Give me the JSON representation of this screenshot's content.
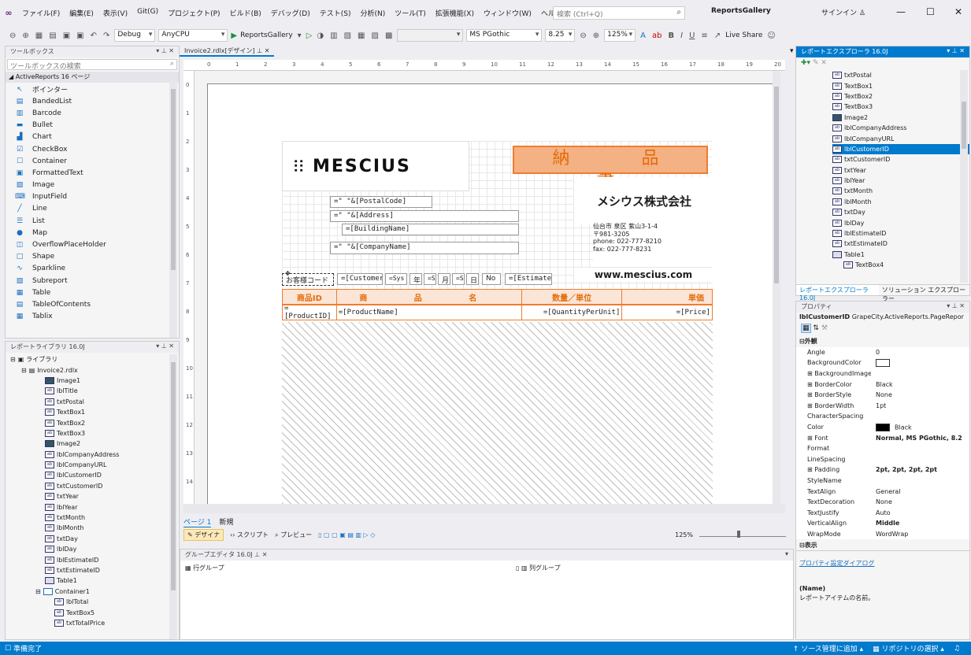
{
  "menu": {
    "items": [
      "ファイル(F)",
      "編集(E)",
      "表示(V)",
      "Git(G)",
      "プロジェクト(P)",
      "ビルド(B)",
      "デバッグ(D)",
      "テスト(S)",
      "分析(N)",
      "ツール(T)",
      "拡張機能(X)",
      "ウィンドウ(W)",
      "ヘルプ(H)"
    ],
    "search_placeholder": "検索 (Ctrl+Q)",
    "solution_name": "ReportsGallery",
    "signin": "サインイン"
  },
  "toolbar": {
    "config": "Debug",
    "platform": "AnyCPU",
    "run_label": "ReportsGallery",
    "font_name": "MS PGothic",
    "font_size": "8.25",
    "zoom": "125%",
    "live_share": "Live Share"
  },
  "toolbox": {
    "title": "ツールボックス",
    "search_placeholder": "ツールボックスの検索",
    "category": "◢ ActiveReports 16 ページ",
    "items": [
      {
        "label": "ポインター",
        "icon": "pointer-icon",
        "glyph": "↖"
      },
      {
        "label": "BandedList",
        "icon": "bandedlist-icon",
        "glyph": "▤"
      },
      {
        "label": "Barcode",
        "icon": "barcode-icon",
        "glyph": "▥"
      },
      {
        "label": "Bullet",
        "icon": "bullet-icon",
        "glyph": "▬"
      },
      {
        "label": "Chart",
        "icon": "chart-icon",
        "glyph": "▟"
      },
      {
        "label": "CheckBox",
        "icon": "checkbox-icon",
        "glyph": "☑"
      },
      {
        "label": "Container",
        "icon": "container-icon",
        "glyph": "☐"
      },
      {
        "label": "FormattedText",
        "icon": "formattedtext-icon",
        "glyph": "▣"
      },
      {
        "label": "Image",
        "icon": "image-icon",
        "glyph": "▨"
      },
      {
        "label": "InputField",
        "icon": "inputfield-icon",
        "glyph": "⌨"
      },
      {
        "label": "Line",
        "icon": "line-icon",
        "glyph": "╱"
      },
      {
        "label": "List",
        "icon": "list-icon",
        "glyph": "☰"
      },
      {
        "label": "Map",
        "icon": "map-icon",
        "glyph": "●"
      },
      {
        "label": "OverflowPlaceHolder",
        "icon": "overflow-icon",
        "glyph": "◫"
      },
      {
        "label": "Shape",
        "icon": "shape-icon",
        "glyph": "□"
      },
      {
        "label": "Sparkline",
        "icon": "sparkline-icon",
        "glyph": "∿"
      },
      {
        "label": "Subreport",
        "icon": "subreport-icon",
        "glyph": "▧"
      },
      {
        "label": "Table",
        "icon": "table-icon",
        "glyph": "▦"
      },
      {
        "label": "TableOfContents",
        "icon": "toc-icon",
        "glyph": "▤"
      },
      {
        "label": "Tablix",
        "icon": "tablix-icon",
        "glyph": "▦"
      }
    ]
  },
  "library": {
    "title": "レポートライブラリ 16.0J",
    "root": "ライブラリ",
    "report": "Invoice2.rdlx",
    "items": [
      {
        "label": "Image1",
        "type": "img"
      },
      {
        "label": "lblTitle",
        "type": "txt"
      },
      {
        "label": "txtPostal",
        "type": "txt"
      },
      {
        "label": "TextBox1",
        "type": "txt"
      },
      {
        "label": "TextBox2",
        "type": "txt"
      },
      {
        "label": "TextBox3",
        "type": "txt"
      },
      {
        "label": "Image2",
        "type": "img"
      },
      {
        "label": "lblCompanyAddress",
        "type": "txt"
      },
      {
        "label": "lblCompanyURL",
        "type": "txt"
      },
      {
        "label": "lblCustomerID",
        "type": "txt"
      },
      {
        "label": "txtCustomerID",
        "type": "txt"
      },
      {
        "label": "txtYear",
        "type": "txt"
      },
      {
        "label": "lblYear",
        "type": "txt"
      },
      {
        "label": "txtMonth",
        "type": "txt"
      },
      {
        "label": "lblMonth",
        "type": "txt"
      },
      {
        "label": "txtDay",
        "type": "txt"
      },
      {
        "label": "lblDay",
        "type": "txt"
      },
      {
        "label": "lblEstimateID",
        "type": "txt"
      },
      {
        "label": "txtEstimateID",
        "type": "txt"
      },
      {
        "label": "Table1",
        "type": "tbl"
      }
    ],
    "container": "Container1",
    "container_items": [
      "lblTotal",
      "TextBox5",
      "txtTotalPrice"
    ]
  },
  "document": {
    "tab": "Invoice2.rdlx[デザイン]",
    "ruler_h": [
      "0",
      "1",
      "2",
      "3",
      "4",
      "5",
      "6",
      "7",
      "8",
      "9",
      "10",
      "11",
      "12",
      "13",
      "14",
      "15",
      "16",
      "17",
      "18",
      "19",
      "20"
    ],
    "ruler_v": [
      "0",
      "1",
      "2",
      "3",
      "4",
      "5",
      "6",
      "7",
      "8",
      "9",
      "10",
      "11",
      "12",
      "13",
      "14"
    ],
    "logo_text": "MESCIUS",
    "title": "納 品 書",
    "company": "メシウス株式会社",
    "address_lines": [
      "仙台市 泉区 紫山3-1-4",
      "〒981-3205",
      "phone: 022-777-8210",
      "fax: 022-777-8231"
    ],
    "url": "www.mescius.com",
    "fields": {
      "postal": "=\" \"&[PostalCode]",
      "address": "=\" \"&[Address]",
      "building": "=[BuildingName]",
      "company_name": "=\" \"&[CompanyName]",
      "customer_label": "お客様コード",
      "customer": "=[Customer",
      "sys": "=Sys",
      "year_label": "年",
      "month_label": "月",
      "day_label": "日",
      "sym": "=S",
      "no_label": "No",
      "estimate": "=[EstimateI"
    },
    "table_headers": [
      "商品ID",
      "商 品 名",
      "数量／単位",
      "単価"
    ],
    "table_detail": [
      "=[ProductID]",
      "=[ProductName]",
      "=[QuantityPerUnit]",
      "=[Price]"
    ],
    "page_tabs": [
      "ページ 1",
      "新規"
    ],
    "mode_tabs": [
      "デザイナ",
      "スクリプト",
      "プレビュー"
    ],
    "zoom": "125%"
  },
  "group_editor": {
    "title": "グループエディタ 16.0J",
    "row_group": "行グループ",
    "col_group": "列グループ"
  },
  "explorer": {
    "title": "レポートエクスプローラ 16.0J",
    "items": [
      {
        "label": "txtPostal",
        "type": "txt"
      },
      {
        "label": "TextBox1",
        "type": "txt"
      },
      {
        "label": "TextBox2",
        "type": "txt"
      },
      {
        "label": "TextBox3",
        "type": "txt"
      },
      {
        "label": "Image2",
        "type": "img"
      },
      {
        "label": "lblCompanyAddress",
        "type": "txt"
      },
      {
        "label": "lblCompanyURL",
        "type": "txt"
      },
      {
        "label": "lblCustomerID",
        "type": "txt",
        "selected": true
      },
      {
        "label": "txtCustomerID",
        "type": "txt"
      },
      {
        "label": "txtYear",
        "type": "txt"
      },
      {
        "label": "lblYear",
        "type": "txt"
      },
      {
        "label": "txtMonth",
        "type": "txt"
      },
      {
        "label": "lblMonth",
        "type": "txt"
      },
      {
        "label": "txtDay",
        "type": "txt"
      },
      {
        "label": "lblDay",
        "type": "txt"
      },
      {
        "label": "lblEstimateID",
        "type": "txt"
      },
      {
        "label": "txtEstimateID",
        "type": "txt"
      },
      {
        "label": "Table1",
        "type": "tbl"
      },
      {
        "label": "TextBox4",
        "type": "txt"
      }
    ],
    "tabs": [
      "レポートエクスプローラ 16.0J",
      "ソリューション エクスプローラー"
    ]
  },
  "properties": {
    "title": "プロパティ",
    "object": "lblCustomerID",
    "object_type": "GrapeCity.ActiveReports.PageRepor",
    "section_appearance": "外観",
    "rows": [
      {
        "name": "Angle",
        "value": "0"
      },
      {
        "name": "BackgroundColor",
        "value": "",
        "swatch": "#ffffff"
      },
      {
        "name": "BackgroundImage",
        "value": "",
        "expand": true
      },
      {
        "name": "BorderColor",
        "value": "Black",
        "expand": true
      },
      {
        "name": "BorderStyle",
        "value": "None",
        "expand": true
      },
      {
        "name": "BorderWidth",
        "value": "1pt",
        "expand": true
      },
      {
        "name": "CharacterSpacing",
        "value": ""
      },
      {
        "name": "Color",
        "value": "Black",
        "swatch": "#000000"
      },
      {
        "name": "Font",
        "value": "Normal, MS PGothic, 8.2",
        "expand": true,
        "bold": true
      },
      {
        "name": "Format",
        "value": ""
      },
      {
        "name": "LineSpacing",
        "value": ""
      },
      {
        "name": "Padding",
        "value": "2pt, 2pt, 2pt, 2pt",
        "expand": true,
        "bold": true
      },
      {
        "name": "StyleName",
        "value": ""
      },
      {
        "name": "TextAlign",
        "value": "General"
      },
      {
        "name": "TextDecoration",
        "value": "None"
      },
      {
        "name": "TextJustify",
        "value": "Auto"
      },
      {
        "name": "VerticalAlign",
        "value": "Middle",
        "bold": true
      },
      {
        "name": "WrapMode",
        "value": "WordWrap"
      }
    ],
    "section_display": "表示",
    "dialog_link": "プロパティ設定ダイアログ",
    "desc_title": "(Name)",
    "desc_text": "レポートアイテムの名前。"
  },
  "status": {
    "ready": "準備完了",
    "source_control": "ソース管理に追加",
    "repo": "リポジトリの選択"
  },
  "colors": {
    "accent": "#007acc",
    "header_orange": "#ed7d31",
    "title_fill": "#f4b183"
  }
}
